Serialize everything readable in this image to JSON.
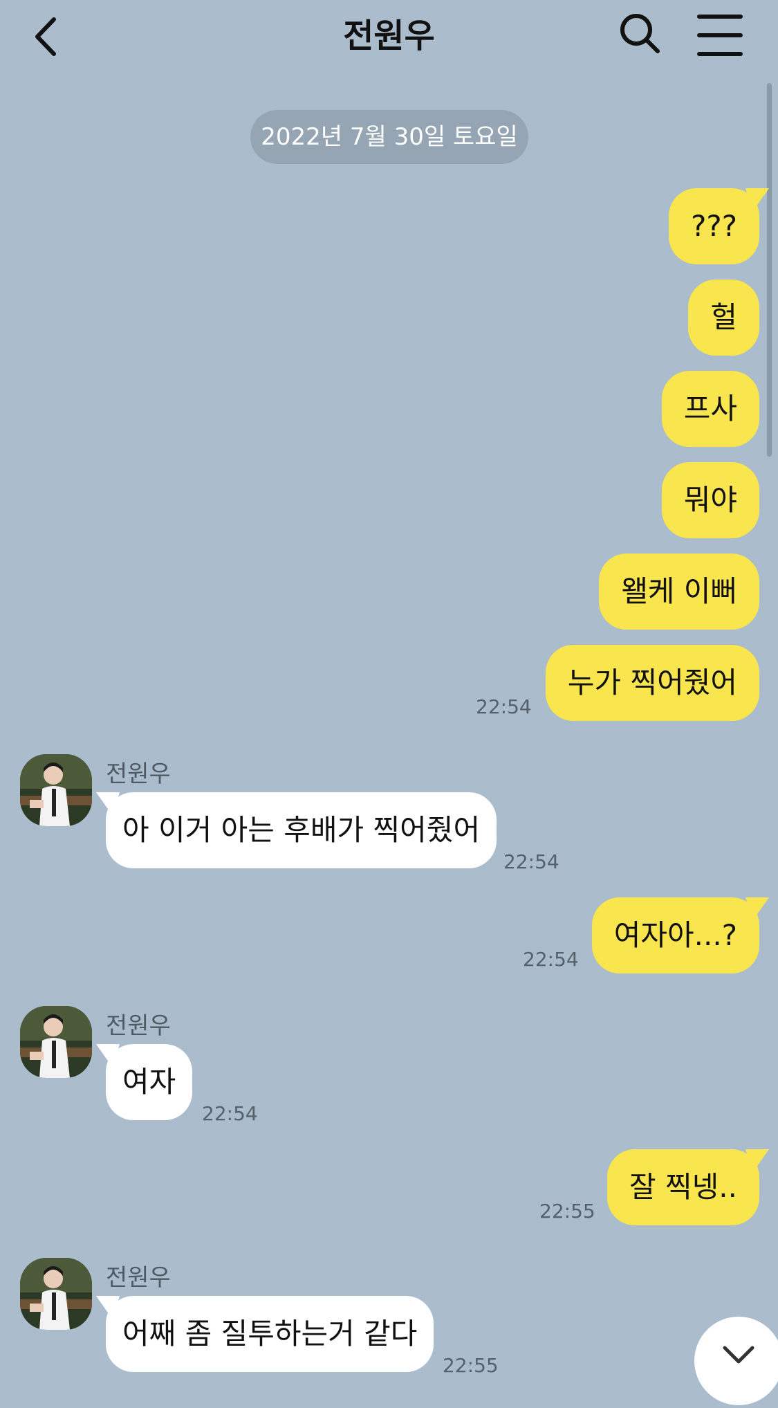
{
  "header": {
    "title": "전원우"
  },
  "date_separator": "2022년 7월 30일 토요일",
  "messages": {
    "m1": {
      "text": "???"
    },
    "m2": {
      "text": "헐"
    },
    "m3": {
      "text": "프사"
    },
    "m4": {
      "text": "뭐야"
    },
    "m5": {
      "text": "왤케 이뻐"
    },
    "m6": {
      "text": "누가 찍어줬어",
      "time": "22:54"
    },
    "m7": {
      "sender": "전원우",
      "text": "아 이거 아는 후배가 찍어줬어",
      "time": "22:54"
    },
    "m8": {
      "text": "여자아...?",
      "time": "22:54"
    },
    "m9": {
      "sender": "전원우",
      "text": "여자",
      "time": "22:54"
    },
    "m10": {
      "text": "잘 찍넹..",
      "time": "22:55"
    },
    "m11": {
      "sender": "전원우",
      "text": "어째 좀 질투하는거 같다",
      "time": "22:55"
    }
  },
  "colors": {
    "background": "#abbdcc",
    "my_bubble": "#f9e54e",
    "other_bubble": "#ffffff"
  },
  "icons": [
    "back-arrow-icon",
    "search-icon",
    "menu-icon",
    "chevron-down-icon"
  ]
}
